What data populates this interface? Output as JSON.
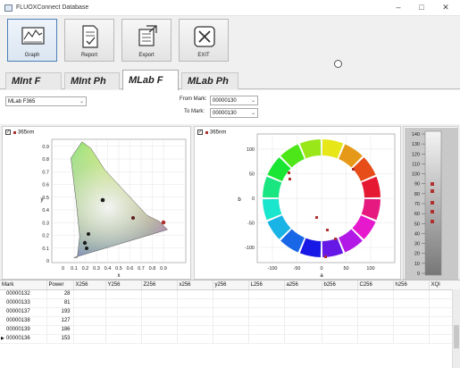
{
  "window": {
    "title": "FLUOXConnect Database"
  },
  "toolbar": {
    "buttons": [
      {
        "label": "Graph",
        "icon": "graph-icon"
      },
      {
        "label": "Report",
        "icon": "report-icon"
      },
      {
        "label": "Export",
        "icon": "export-icon"
      },
      {
        "label": "EXIT",
        "icon": "exit-icon"
      }
    ]
  },
  "tabs": [
    "MInt F",
    "MInt Ph",
    "MLab F",
    "MLab Ph"
  ],
  "active_tab": "MLab F",
  "filters": {
    "measurement": "MLab F365",
    "from_mark_label": "From Mark:",
    "from_mark": "00000130",
    "to_mark_label": "To Mark:",
    "to_mark": "00000130"
  },
  "left_chart": {
    "legend": "365nm",
    "x_label": "x",
    "y_label": "y",
    "x_ticks": [
      "0",
      "0.1",
      "0.2",
      "0.3",
      "0.4",
      "0.5",
      "0.6",
      "0.7",
      "0.8",
      "0.9"
    ],
    "y_ticks": [
      "0",
      "0.1",
      "0.2",
      "0.3",
      "0.4",
      "0.5",
      "0.6",
      "0.7",
      "0.8",
      "0.9"
    ]
  },
  "right_chart": {
    "legend": "365nm",
    "x_label": "a",
    "y_label": "b",
    "x_ticks": [
      "-100",
      "-50",
      "0",
      "50",
      "100"
    ],
    "y_ticks": [
      "-100",
      "-50",
      "0",
      "50",
      "100"
    ]
  },
  "l_scale": {
    "ticks": [
      "140",
      "130",
      "120",
      "110",
      "100",
      "90",
      "80",
      "70",
      "60",
      "50",
      "40",
      "30",
      "20",
      "10",
      "0"
    ]
  },
  "grid": {
    "columns": [
      "Mark",
      "Power",
      "X256",
      "Y256",
      "Z256",
      "x256",
      "y256",
      "L256",
      "a256",
      "b256",
      "C256",
      "h256",
      "XQI"
    ],
    "rows": [
      {
        "mark": "00000132",
        "power": "28"
      },
      {
        "mark": "00000133",
        "power": "81"
      },
      {
        "mark": "00000137",
        "power": "193"
      },
      {
        "mark": "00000138",
        "power": "127"
      },
      {
        "mark": "00000139",
        "power": "186"
      },
      {
        "mark": "00000136",
        "power": "153"
      }
    ],
    "selected_row": 5
  },
  "colors": {
    "accent": "#4a7fb8",
    "marker": "#b03030"
  }
}
